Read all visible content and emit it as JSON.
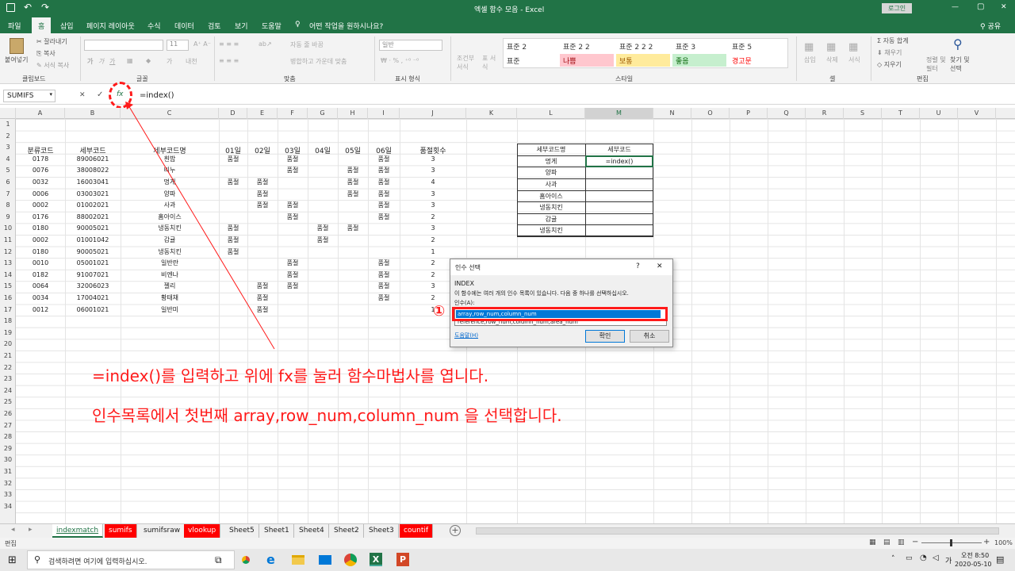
{
  "title_bar": {
    "window_title": "엑셀 함수 모음 - Excel",
    "signin": "로그인",
    "minimize": "—",
    "restore": "▢",
    "close": "✕"
  },
  "ribbon_tabs": [
    "파일",
    "홈",
    "삽입",
    "페이지 레이아웃",
    "수식",
    "데이터",
    "검토",
    "보기",
    "도움말"
  ],
  "tell_me": "어떤 작업을 원하시나요?",
  "share": "공유",
  "ribbon": {
    "clipboard": {
      "paste": "붙여넣기",
      "cut": "잘라내기",
      "copy": "복사",
      "painter": "서식 복사",
      "label": "클립보드"
    },
    "font": {
      "label": "글꼴",
      "size": "11"
    },
    "align": {
      "wrap": "자동 줄 바꿈",
      "merge": "병합하고 가운데 맞춤",
      "label": "맞춤"
    },
    "number": {
      "format": "일반",
      "label": "표시 형식"
    },
    "styles": {
      "cond": "조건부 서식",
      "table": "표 서식",
      "cells": [
        "표준 2",
        "표준 2 2",
        "표준 2 2 2",
        "표준 3",
        "표준 5",
        "표준",
        "나쁨",
        "보통",
        "좋음",
        "경고문"
      ],
      "label": "스타일"
    },
    "cells_grp": {
      "insert": "삽입",
      "delete": "삭제",
      "format": "서식",
      "label": "셀"
    },
    "edit": {
      "autosum": "자동 합계",
      "fill": "채우기",
      "clear": "지우기",
      "sort": "정렬 및 필터",
      "find": "찾기 및 선택",
      "label": "편집"
    }
  },
  "formula_bar": {
    "name_box": "SUMIFS",
    "cancel": "✕",
    "enter": "✓",
    "fx": "fx",
    "formula": "=index()"
  },
  "columns": [
    "A",
    "B",
    "C",
    "D",
    "E",
    "F",
    "G",
    "H",
    "I",
    "J",
    "K",
    "L",
    "M",
    "N",
    "O",
    "P",
    "Q",
    "R",
    "S",
    "T",
    "U",
    "V"
  ],
  "rows": [
    "1",
    "2",
    "3",
    "4",
    "5",
    "6",
    "7",
    "8",
    "9",
    "10",
    "11",
    "12",
    "13",
    "14",
    "15",
    "16",
    "17",
    "18",
    "19",
    "20",
    "21",
    "22",
    "23",
    "24",
    "25",
    "26",
    "27",
    "28",
    "29",
    "30",
    "31",
    "32",
    "33",
    "34"
  ],
  "table": {
    "headers": [
      "분류코드",
      "세부코드",
      "세부코드명",
      "01일",
      "02일",
      "03일",
      "04일",
      "05일",
      "06일",
      "품절횟수"
    ],
    "rows": [
      [
        "0178",
        "89006021",
        "흰밥",
        "품절",
        "",
        "품절",
        "",
        "",
        "품절",
        "3"
      ],
      [
        "0076",
        "38008022",
        "비누",
        "",
        "",
        "품절",
        "",
        "품절",
        "품절",
        "3"
      ],
      [
        "0032",
        "16003041",
        "멍게",
        "품절",
        "품절",
        "",
        "",
        "품절",
        "품절",
        "4"
      ],
      [
        "0006",
        "03003021",
        "양파",
        "",
        "품절",
        "",
        "",
        "품절",
        "품절",
        "3"
      ],
      [
        "0002",
        "01002021",
        "사과",
        "",
        "품절",
        "품절",
        "",
        "",
        "품절",
        "3"
      ],
      [
        "0176",
        "88002021",
        "홈아이스",
        "",
        "",
        "품절",
        "",
        "",
        "품절",
        "2"
      ],
      [
        "0180",
        "90005021",
        "냉동치킨",
        "품절",
        "",
        "",
        "품절",
        "품절",
        "",
        "3"
      ],
      [
        "0002",
        "01001042",
        "감귤",
        "품절",
        "",
        "",
        "품절",
        "",
        "",
        "2"
      ],
      [
        "0180",
        "90005021",
        "냉동치킨",
        "품절",
        "",
        "",
        "",
        "",
        "",
        "1"
      ],
      [
        "0010",
        "05001021",
        "일반란",
        "",
        "",
        "품절",
        "",
        "",
        "품절",
        "2"
      ],
      [
        "0182",
        "91007021",
        "비엔나",
        "",
        "",
        "품절",
        "",
        "",
        "품절",
        "2"
      ],
      [
        "0064",
        "32006023",
        "젤리",
        "",
        "품절",
        "품절",
        "",
        "",
        "품절",
        "3"
      ],
      [
        "0034",
        "17004021",
        "황태채",
        "",
        "품절",
        "",
        "",
        "",
        "품절",
        "2"
      ],
      [
        "0012",
        "06001021",
        "일반미",
        "",
        "품절",
        "",
        "",
        "",
        "",
        "1"
      ]
    ]
  },
  "lookup": {
    "headers": [
      "세부코드명",
      "세부코드"
    ],
    "names": [
      "멍게",
      "양파",
      "사과",
      "홈아이스",
      "냉동치킨",
      "감귤",
      "냉동치킨"
    ],
    "active": "=index()"
  },
  "dialog": {
    "title": "인수 선택",
    "help_q": "?",
    "close": "✕",
    "fn": "INDEX",
    "desc": "이 함수에는 여러 개의 인수 목록이 있습니다. 다음 중 하나를 선택하십시오.",
    "args_label": "인수(A):",
    "opt1": "array,row_num,column_num",
    "opt2": "reference,row_num,column_num,area_num",
    "help_link": "도움말(H)",
    "ok": "확인",
    "cancel": "취소"
  },
  "marker": "①",
  "annotation": {
    "line1": "=index()를 입력하고 위에 fx를 눌러 함수마법사를 엽니다.",
    "line2": "인수목록에서 첫번째 array,row_num,column_num  을 선택합니다."
  },
  "sheets": [
    "indexmatch",
    "sumifs",
    "sumifsraw",
    "vlookup",
    "Sheet5",
    "Sheet1",
    "Sheet4",
    "Sheet2",
    "Sheet3",
    "countif"
  ],
  "status": {
    "mode": "편집",
    "zoom": "100%"
  },
  "taskbar": {
    "search": "검색하려면 여기에 입력하십시오.",
    "time": "오전 8:50",
    "date": "2020-05-10"
  },
  "colors": {
    "excel_green": "#217346",
    "annotation_red": "#ff1a1a",
    "sheet_red": "#ff0000"
  }
}
